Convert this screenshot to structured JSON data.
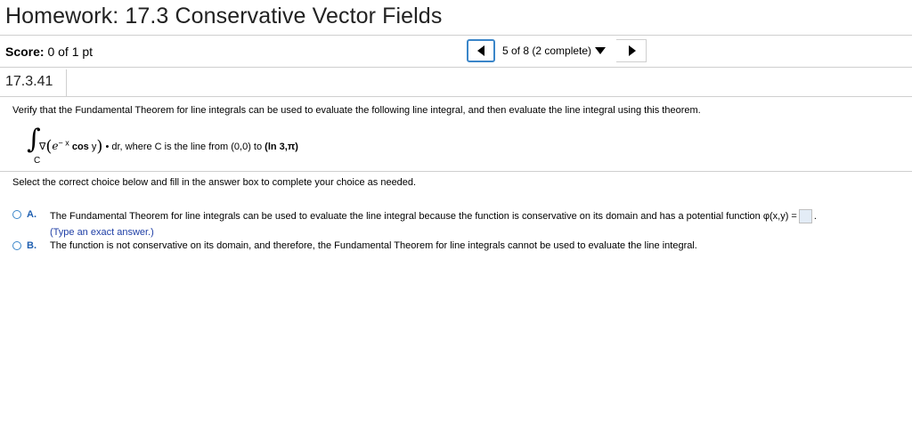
{
  "header": {
    "title": "Homework: 17.3 Conservative Vector Fields"
  },
  "score": {
    "label": "Score:",
    "value": "0 of 1 pt"
  },
  "navigation": {
    "progress_label": "5 of 8 (2 complete)"
  },
  "question": {
    "number": "17.3.41",
    "prompt": "Verify that the Fundamental Theorem for line integrals can be used to evaluate the following line integral, and then evaluate the line integral using this theorem.",
    "integral": {
      "nabla": "∇",
      "e": "e",
      "exponent": "− x",
      "func": "cos",
      "var": "y",
      "dot": "•",
      "tail": "dr, where C is the line from (0,0) to ",
      "endpoint": "(ln 3,π)",
      "subscript": "C"
    },
    "instruction": "Select the correct choice below and fill in the answer box to complete your choice as needed.",
    "choices": [
      {
        "letter": "A.",
        "text": "The Fundamental Theorem for line integrals can be used to evaluate the line integral because the function is conservative on its domain and has a potential function φ(x,y) =",
        "suffix": ".",
        "hint": "(Type an exact answer.)"
      },
      {
        "letter": "B.",
        "text": "The function is not conservative on its domain, and therefore, the Fundamental Theorem for line integrals cannot be used to evaluate the line integral."
      }
    ]
  },
  "colors": {
    "accent": "#3b86c9",
    "choice_letter": "#1f5fb0",
    "hint": "#1f3fa6",
    "answer_box_fill": "#e3ecf6"
  },
  "icons": {
    "prev": "triangle-left-icon",
    "next": "triangle-right-icon",
    "dropdown": "triangle-down-icon"
  }
}
